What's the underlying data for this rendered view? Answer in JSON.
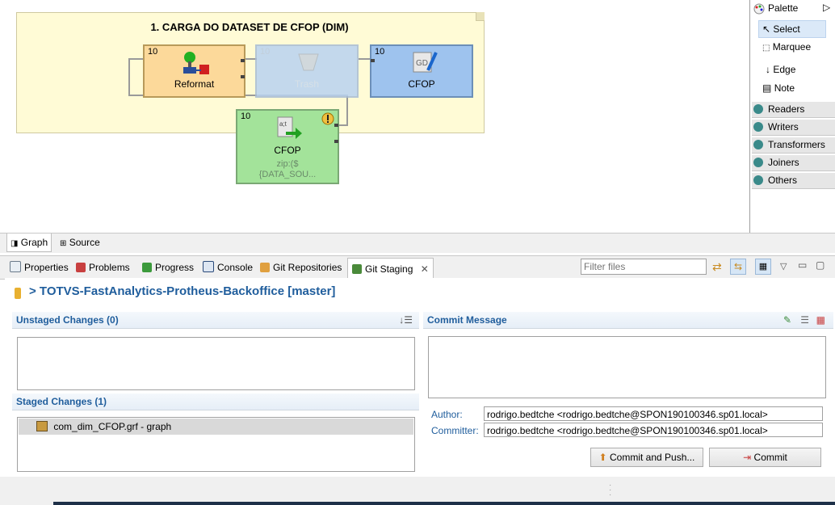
{
  "graph": {
    "note_title": "1. CARGA DO DATASET DE CFOP (DIM)",
    "nodes": [
      {
        "count": "10",
        "label": "Reformat"
      },
      {
        "count": "10",
        "label": "Trash"
      },
      {
        "count": "10",
        "label": "CFOP"
      },
      {
        "count": "10",
        "label": "CFOP",
        "sub1": "zip:($",
        "sub2": "{DATA_SOU..."
      }
    ]
  },
  "palette": {
    "title": "Palette",
    "tools": [
      "Select",
      "Marquee",
      "Edge",
      "Note"
    ],
    "groups": [
      "Readers",
      "Writers",
      "Transformers",
      "Joiners",
      "Others"
    ]
  },
  "editor_tabs": [
    "Graph",
    "Source"
  ],
  "view_tabs": [
    "Properties",
    "Problems",
    "Progress",
    "Console",
    "Git Repositories",
    "Git Staging"
  ],
  "filter_placeholder": "Filter files",
  "staging": {
    "repo": "> TOTVS-FastAnalytics-Protheus-Backoffice [master]",
    "unstaged_title": "Unstaged Changes (0)",
    "staged_title": "Staged Changes (1)",
    "staged_files": [
      "com_dim_CFOP.grf - graph"
    ],
    "commit_title": "Commit Message",
    "author_label": "Author:",
    "author_value": "rodrigo.bedtche <rodrigo.bedtche@SPON190100346.sp01.local>",
    "committer_label": "Committer:",
    "committer_value": "rodrigo.bedtche <rodrigo.bedtche@SPON190100346.sp01.local>",
    "commit_push_label": "Commit and Push...",
    "commit_label": "Commit"
  }
}
